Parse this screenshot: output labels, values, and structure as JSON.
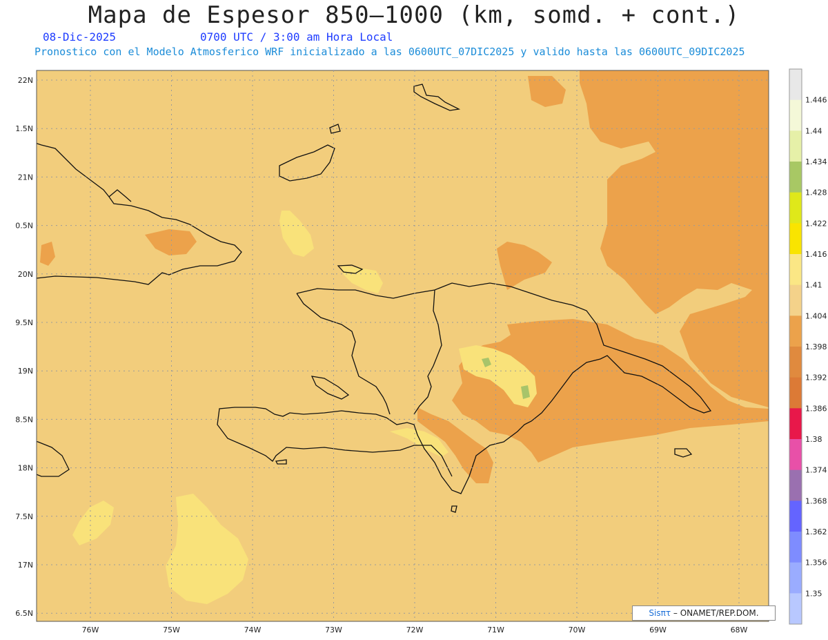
{
  "header": {
    "title": "Mapa de Espesor 850–1000 (km, somd. + cont.)",
    "date": "08-Dic-2025",
    "time": "0700 UTC / 3:00 am Hora Local",
    "description": "Pronostico con el Modelo Atmosferico WRF inicializado a las 0600UTC_07DIC2025 y valido hasta las  0600UTC_09DIC2025"
  },
  "map": {
    "lat_labels": [
      "22N",
      "1.5N",
      "21N",
      "0.5N",
      "20N",
      "9.5N",
      "19N",
      "8.5N",
      "18N",
      "7.5N",
      "17N",
      "6.5N"
    ],
    "lon_labels": [
      "76W",
      "75W",
      "74W",
      "73W",
      "72W",
      "71W",
      "70W",
      "69W",
      "68W"
    ],
    "fill_colors": {
      "base": "#f2cd7c",
      "warm": "#eca24b",
      "warmer": "#e08e3e",
      "yellow": "#f9e27a",
      "green": "#a8c46a"
    }
  },
  "legend": {
    "items": [
      {
        "label": "",
        "color": "#e8e8e8"
      },
      {
        "label": "1.446",
        "color": "#f4f8d8"
      },
      {
        "label": "1.44",
        "color": "#e6f0a8"
      },
      {
        "label": "1.434",
        "color": "#a8c864"
      },
      {
        "label": "1.428",
        "color": "#dfe81a"
      },
      {
        "label": "1.422",
        "color": "#f9e400"
      },
      {
        "label": "1.416",
        "color": "#fbe785"
      },
      {
        "label": "1.41",
        "color": "#f4d28a"
      },
      {
        "label": "1.404",
        "color": "#eca24b"
      },
      {
        "label": "1.398",
        "color": "#e08a3e"
      },
      {
        "label": "1.392",
        "color": "#dc7a36"
      },
      {
        "label": "1.386",
        "color": "#e8184a"
      },
      {
        "label": "1.38",
        "color": "#e850a8"
      },
      {
        "label": "1.374",
        "color": "#9a70b0"
      },
      {
        "label": "1.368",
        "color": "#6464ff"
      },
      {
        "label": "1.362",
        "color": "#7e8cff"
      },
      {
        "label": "1.356",
        "color": "#9aacff"
      },
      {
        "label": "1.35",
        "color": "#b8c8ff"
      }
    ]
  },
  "credit": {
    "sis": "Sisπτ",
    "text": " – ONAMET/REP.DOM."
  }
}
